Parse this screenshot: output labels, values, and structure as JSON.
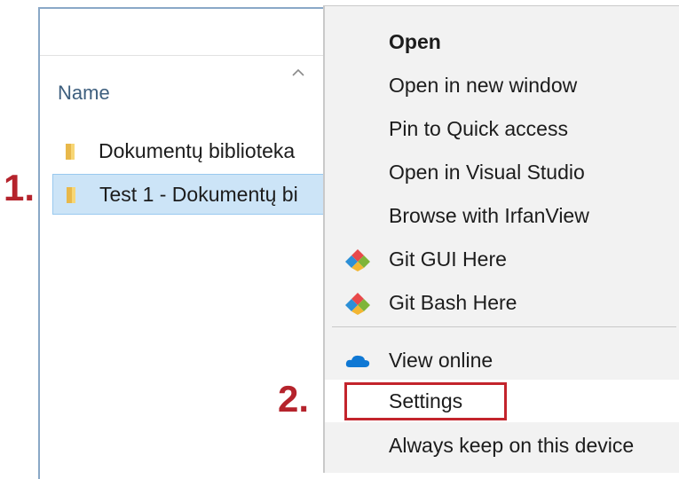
{
  "explorer": {
    "column_header": "Name",
    "rows": [
      {
        "label": "Dokumentų biblioteka",
        "icon": "folder-icon",
        "selected": false
      },
      {
        "label": "Test 1 - Dokumentų bi",
        "icon": "folder-icon",
        "selected": true
      }
    ]
  },
  "annotations": {
    "step1": "1.",
    "step2": "2."
  },
  "context_menu": {
    "items": [
      {
        "label": "Open",
        "bold": true
      },
      {
        "label": "Open in new window"
      },
      {
        "label": "Pin to Quick access"
      },
      {
        "label": "Open in Visual Studio"
      },
      {
        "label": "Browse with IrfanView"
      },
      {
        "label": "Git GUI Here",
        "icon": "git-icon"
      },
      {
        "label": "Git Bash Here",
        "icon": "git-icon"
      },
      {
        "label": "View online",
        "icon": "onedrive-cloud-icon"
      },
      {
        "label": "Settings",
        "highlighted": true
      },
      {
        "label": "Always keep on this device"
      }
    ]
  },
  "colors": {
    "annotation_red": "#b5232c",
    "selection_blue": "#cce4f7",
    "menu_bg": "#f2f2f2"
  }
}
